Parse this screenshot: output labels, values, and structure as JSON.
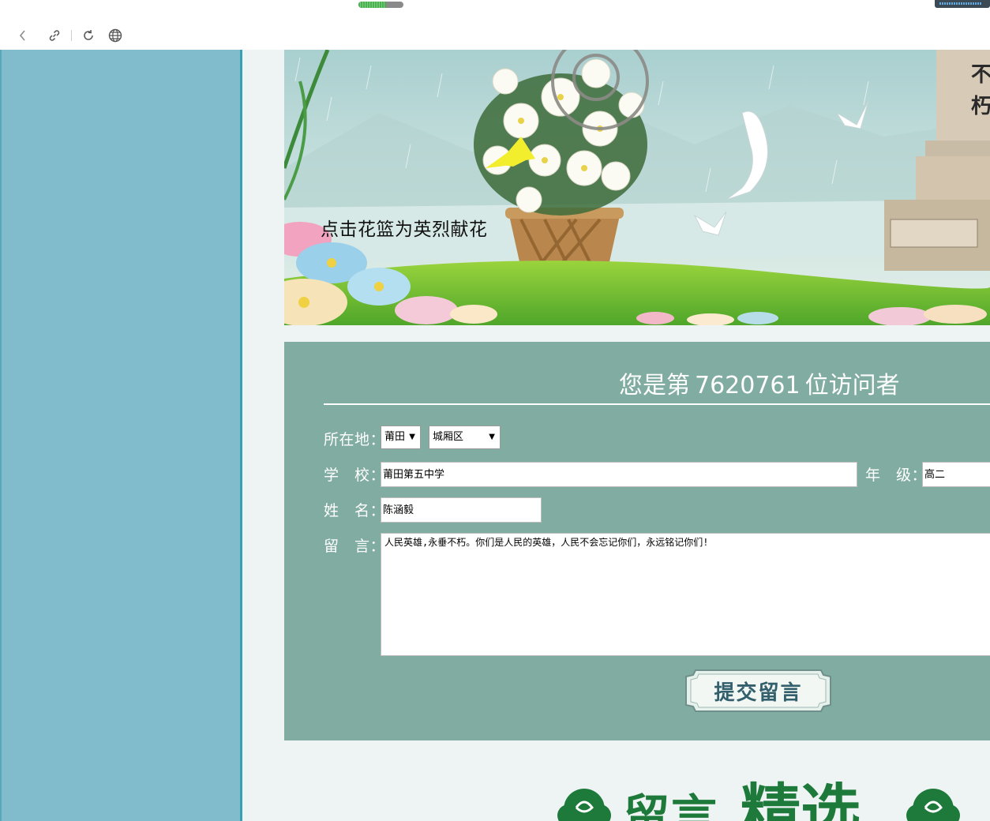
{
  "browser": {
    "back_icon": "chevron-left-icon",
    "link_icon": "link-icon",
    "reload_icon": "reload-icon",
    "globe_icon": "globe-icon"
  },
  "banner": {
    "caption": "点击花篮为英烈献花",
    "monument_text": "垂不朽"
  },
  "visitor": {
    "prefix": "您是第",
    "count": "7620761",
    "suffix": "位访问者"
  },
  "form": {
    "location_label": "所在地：",
    "city_value": "莆田",
    "district_value": "城厢区",
    "school_label": "学　校：",
    "school_value": "莆田第五中学",
    "grade_label": "年　级：",
    "grade_value": "高二",
    "name_label": "姓　名：",
    "name_value": "陈涵毅",
    "message_label": "留　言：",
    "message_value": "人民英雄,永垂不朽。你们是人民的英雄，人民不会忘记你们，永远铭记你们!",
    "submit_label": "提交留言"
  },
  "section": {
    "heading_small": "留言",
    "heading_big": "精选"
  },
  "colors": {
    "sidebar": "#80bccc",
    "panel": "#80aca2",
    "heading_green": "#1e7a3a"
  }
}
